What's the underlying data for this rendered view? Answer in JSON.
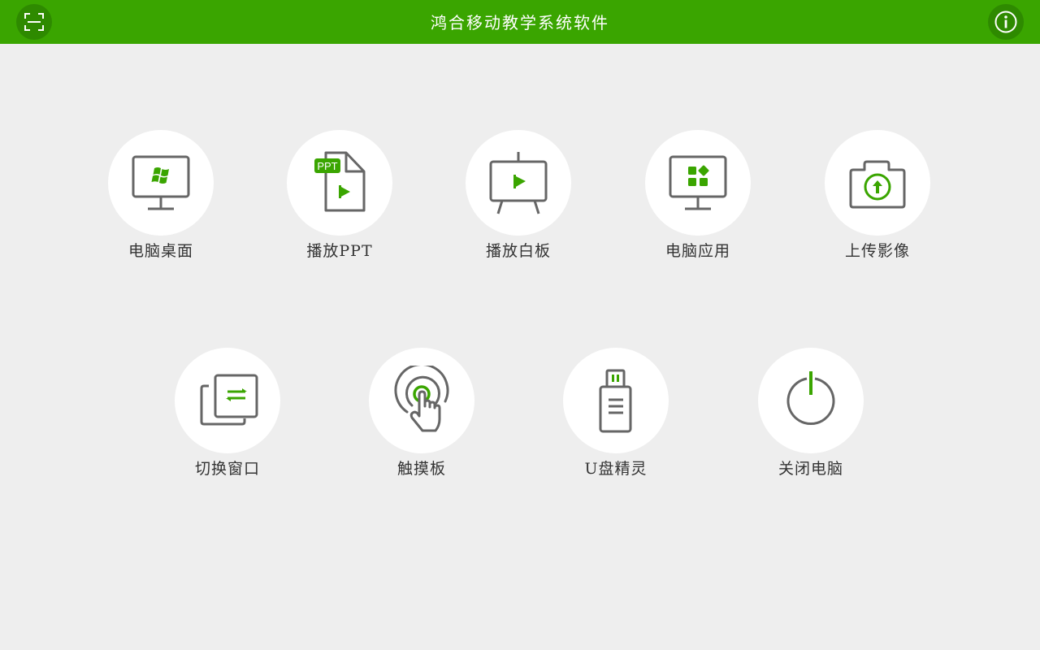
{
  "header": {
    "title": "鸿合移动教学系统软件",
    "left_icon": "scan-icon",
    "right_icon": "info-icon",
    "background_color": "#3aa500"
  },
  "colors": {
    "accent": "#3aa500",
    "icon_stroke": "#666666",
    "background": "#eeeeee"
  },
  "tiles": [
    {
      "label": "电脑桌面",
      "icon": "windows-desktop-icon"
    },
    {
      "label": "播放PPT",
      "icon": "ppt-file-icon",
      "badge": "PPT"
    },
    {
      "label": "播放白板",
      "icon": "whiteboard-play-icon"
    },
    {
      "label": "电脑应用",
      "icon": "computer-apps-icon"
    },
    {
      "label": "上传影像",
      "icon": "camera-upload-icon"
    },
    {
      "label": "切换窗口",
      "icon": "switch-window-icon"
    },
    {
      "label": "触摸板",
      "icon": "touchpad-icon"
    },
    {
      "label": "U盘精灵",
      "icon": "usb-drive-icon"
    },
    {
      "label": "关闭电脑",
      "icon": "power-icon"
    }
  ]
}
